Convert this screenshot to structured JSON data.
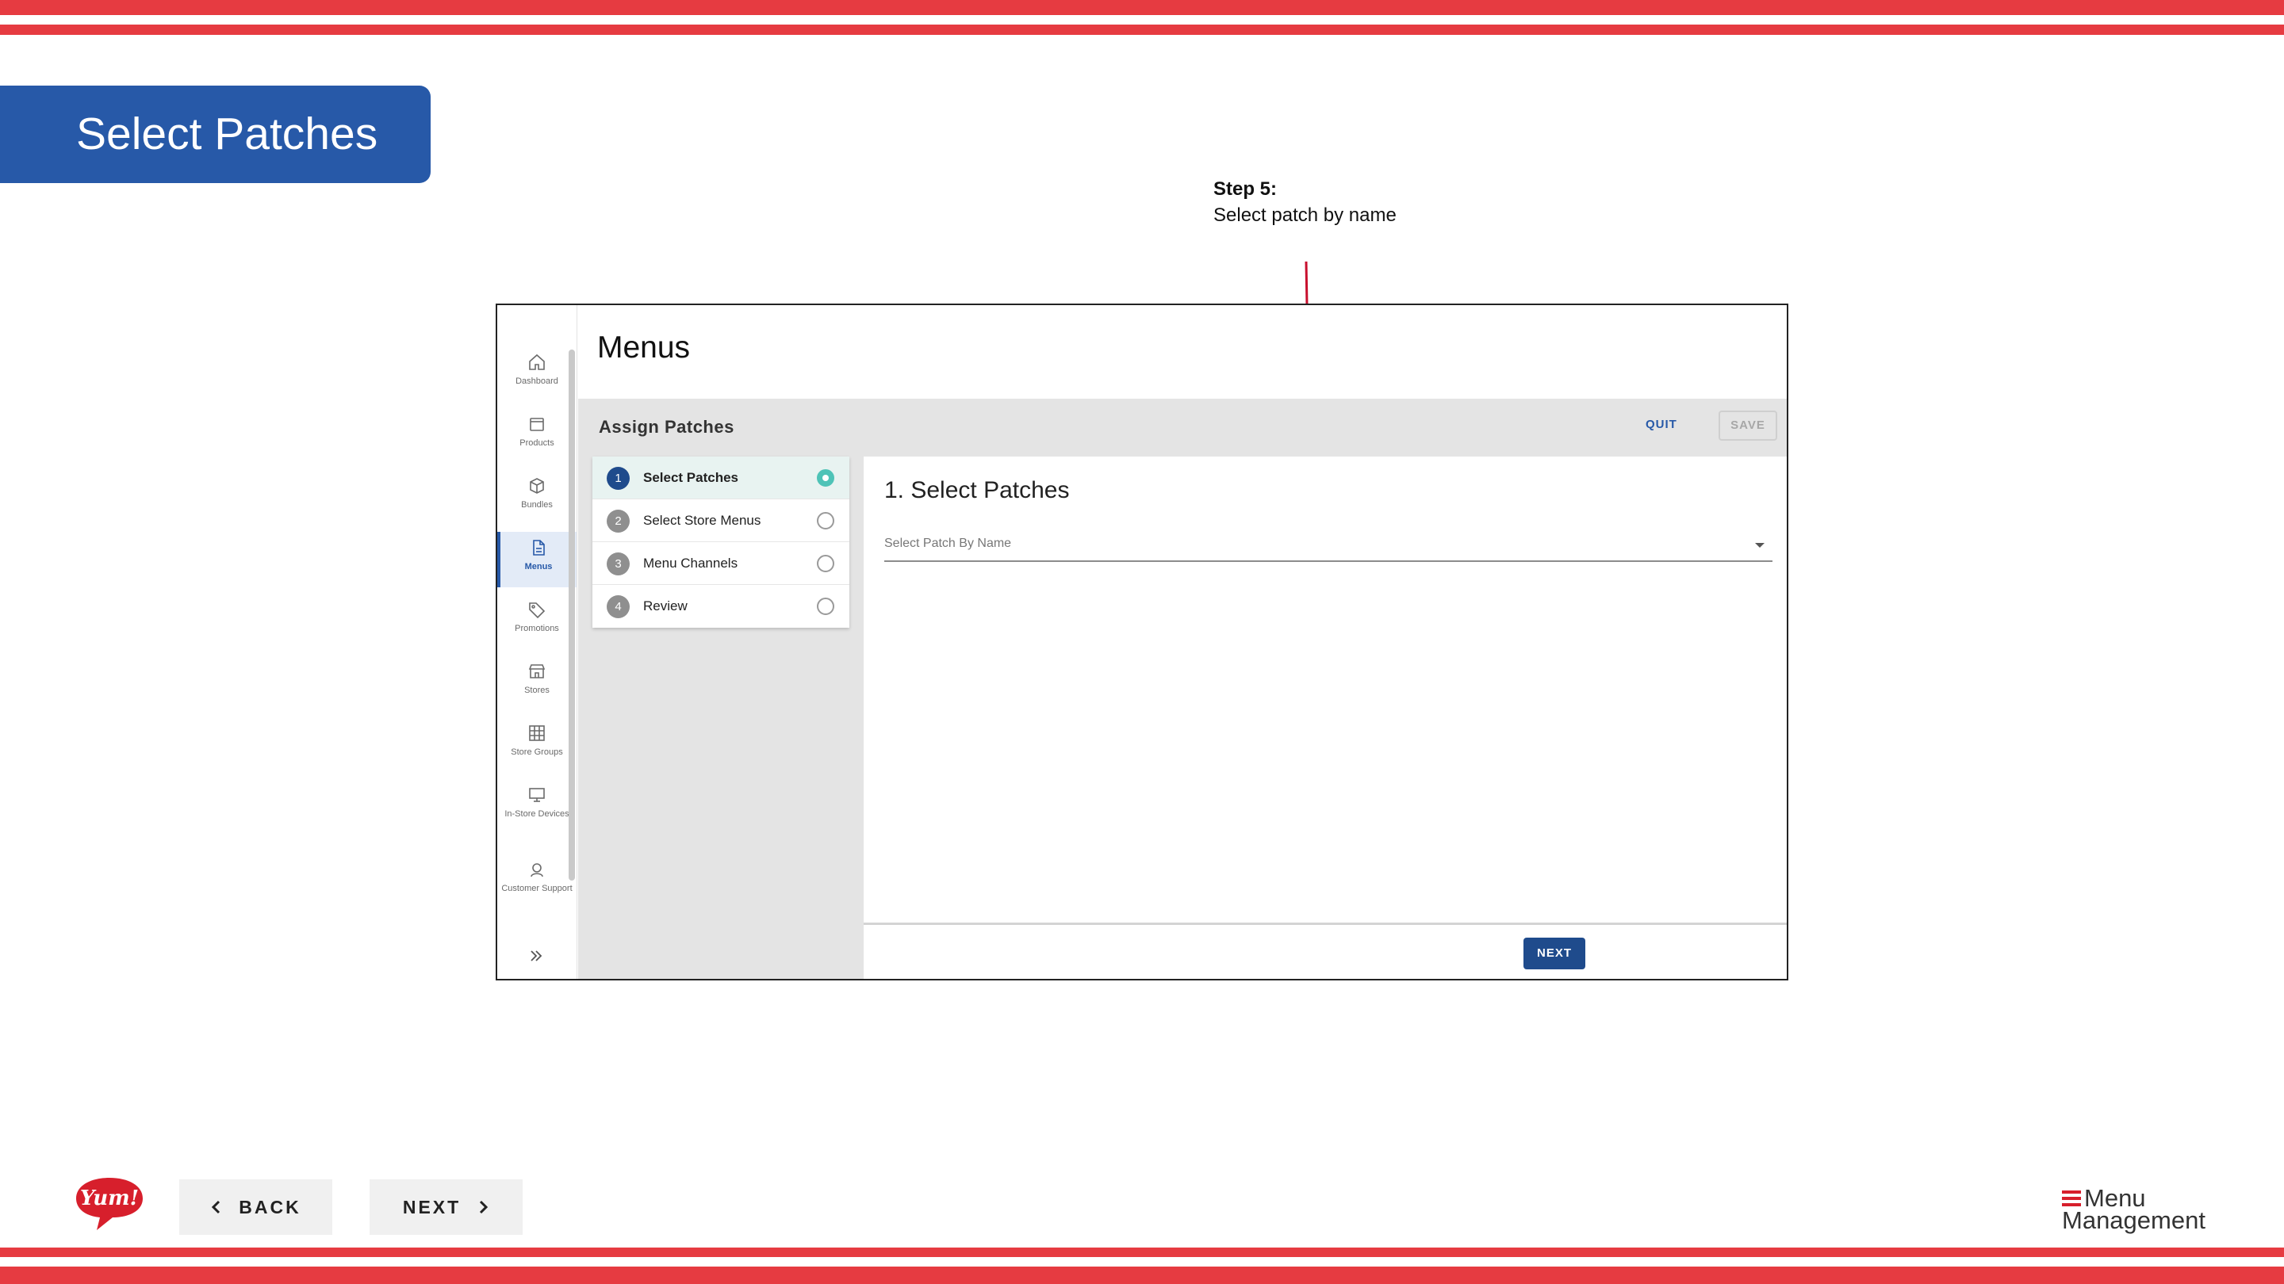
{
  "slide": {
    "title": "Select Patches",
    "step_note": {
      "heading": "Step 5:",
      "text": "Select patch by name"
    },
    "back_label": "BACK",
    "next_label": "NEXT",
    "brand_left": "Yum!",
    "brand_right": {
      "line1": "Menu",
      "line2": "Management"
    }
  },
  "app": {
    "sidebar": {
      "items": [
        {
          "label": "Dashboard",
          "icon": "home-icon"
        },
        {
          "label": "Products",
          "icon": "box-icon"
        },
        {
          "label": "Bundles",
          "icon": "cube-icon"
        },
        {
          "label": "Menus",
          "icon": "document-icon",
          "active": true
        },
        {
          "label": "Promotions",
          "icon": "tag-icon"
        },
        {
          "label": "Stores",
          "icon": "storefront-icon"
        },
        {
          "label": "Store Groups",
          "icon": "grid-icon"
        },
        {
          "label": "In-Store Devices",
          "icon": "monitor-icon"
        },
        {
          "label": "Customer Support",
          "icon": "headset-icon"
        }
      ]
    },
    "page_title": "Menus",
    "assign": {
      "title": "Assign Patches",
      "quit_label": "QUIT",
      "save_label": "SAVE"
    },
    "steps": [
      {
        "number": "1",
        "label": "Select Patches",
        "active": true
      },
      {
        "number": "2",
        "label": "Select Store Menus"
      },
      {
        "number": "3",
        "label": "Menu Channels"
      },
      {
        "number": "4",
        "label": "Review"
      }
    ],
    "panel": {
      "title": "1. Select Patches",
      "select_placeholder": "Select Patch By Name",
      "next_label": "NEXT"
    }
  },
  "colors": {
    "stripe": "#e63b41",
    "title_tab": "#2759a8",
    "primary": "#1f4b8c",
    "active_radio": "#4ec3b7",
    "arrow": "#c8102e"
  }
}
